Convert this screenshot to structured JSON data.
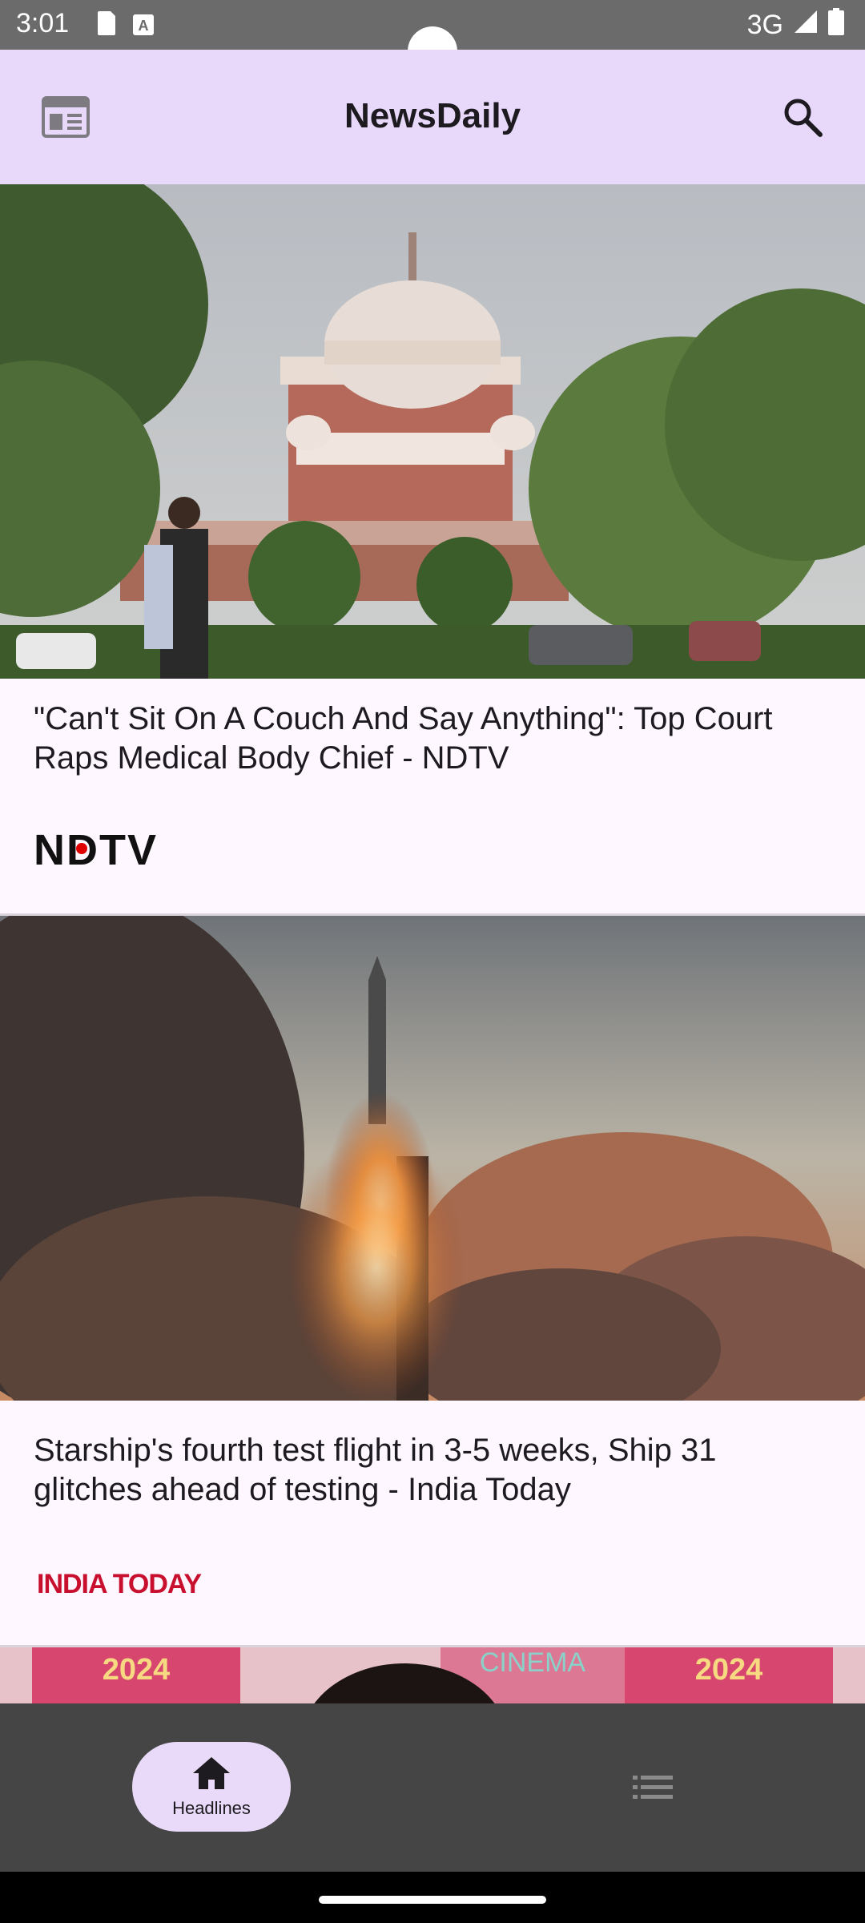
{
  "status_bar": {
    "time": "3:01",
    "network": "3G",
    "icons": [
      "sd-card-icon",
      "a-badge-icon",
      "signal-icon",
      "battery-icon"
    ]
  },
  "app_bar": {
    "title": "NewsDaily",
    "left_icon": "newspaper-icon",
    "right_icon": "search-icon"
  },
  "articles": [
    {
      "title": "\"Can't Sit On A Couch And Say Anything\": Top Court Raps Medical Body Chief - NDTV",
      "source": "NDTV",
      "image": "supreme-court-photo"
    },
    {
      "title": "Starship's fourth test flight in 3-5 weeks, Ship 31 glitches ahead of testing - India Today",
      "source": "INDIA TODAY",
      "image": "rocket-launch-photo"
    }
  ],
  "partial_image_text": {
    "banner_left": "2024",
    "banner_center": "CINEMA",
    "banner_right": "2024"
  },
  "bottom_nav": {
    "headlines_label": "Headlines",
    "items": [
      "home-icon",
      "list-icon"
    ]
  },
  "colors": {
    "app_bar_bg": "#e8d9fb",
    "nav_bg": "#454545",
    "nav_active_pill": "#e8daf8",
    "india_today_red": "#c8102e"
  }
}
